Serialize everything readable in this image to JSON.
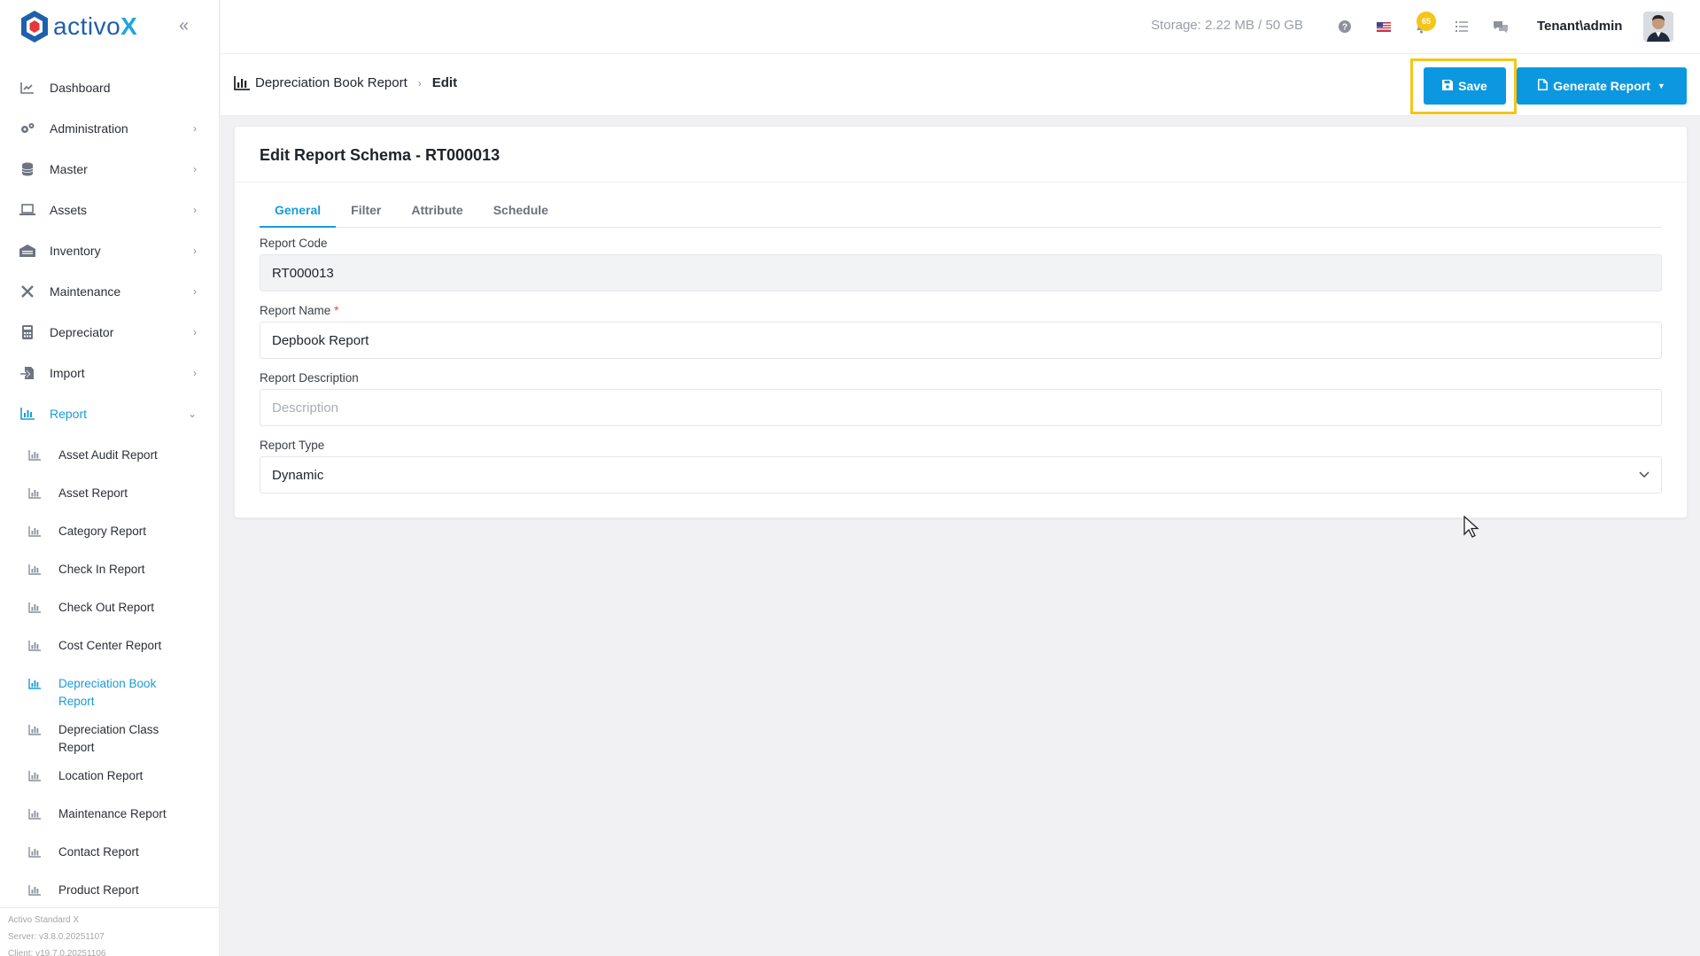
{
  "app": {
    "logo_text": "activo",
    "logo_x": "X"
  },
  "sidebar": {
    "items": [
      {
        "label": "Dashboard",
        "icon": "chart-line-icon",
        "has_children": false
      },
      {
        "label": "Administration",
        "icon": "cogs-icon",
        "has_children": true
      },
      {
        "label": "Master",
        "icon": "database-icon",
        "has_children": true
      },
      {
        "label": "Assets",
        "icon": "laptop-icon",
        "has_children": true
      },
      {
        "label": "Inventory",
        "icon": "warehouse-icon",
        "has_children": true
      },
      {
        "label": "Maintenance",
        "icon": "tools-icon",
        "has_children": true
      },
      {
        "label": "Depreciator",
        "icon": "calculator-icon",
        "has_children": true
      },
      {
        "label": "Import",
        "icon": "file-import-icon",
        "has_children": true
      },
      {
        "label": "Report",
        "icon": "chart-bar-icon",
        "has_children": true,
        "active": true
      }
    ],
    "report_children": [
      "Asset Audit Report",
      "Asset Report",
      "Category Report",
      "Check In Report",
      "Check Out Report",
      "Cost Center Report",
      "Depreciation Book Report",
      "Depreciation Class Report",
      "Location Report",
      "Maintenance Report",
      "Contact Report",
      "Product Report"
    ],
    "active_child": "Depreciation Book Report",
    "footer": {
      "line1": "Activo Standard X",
      "line2": "Server: v3.8.0.20251107",
      "line3": "Client: v19.7.0.20251106"
    }
  },
  "topbar": {
    "storage": "Storage: 2.22 MB / 50 GB",
    "notification_count": "65",
    "user": "Tenant\\admin"
  },
  "header": {
    "breadcrumb_parent": "Depreciation Book Report",
    "breadcrumb_current": "Edit",
    "save_label": "Save",
    "generate_label": "Generate Report"
  },
  "card": {
    "title": "Edit Report Schema - RT000013",
    "tabs": [
      "General",
      "Filter",
      "Attribute",
      "Schedule"
    ],
    "active_tab": "General",
    "fields": {
      "code_label": "Report Code",
      "code_value": "RT000013",
      "name_label": "Report Name",
      "name_required": "*",
      "name_value": "Depbook Report",
      "desc_label": "Report Description",
      "desc_placeholder": "Description",
      "type_label": "Report Type",
      "type_value": "Dynamic"
    }
  },
  "colors": {
    "accent": "#1a9bd7",
    "button": "#0c98e0",
    "highlight": "#f5c518"
  }
}
